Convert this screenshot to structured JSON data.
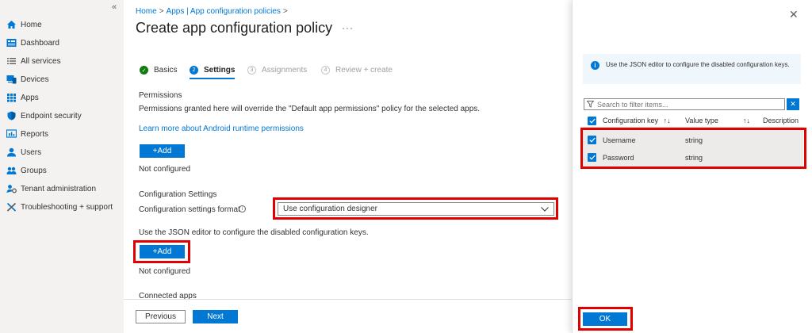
{
  "sidebar": {
    "collapse_label": "«",
    "items": [
      {
        "label": "Home",
        "icon": "home-icon",
        "color": "#0078d4"
      },
      {
        "label": "Dashboard",
        "icon": "dashboard-icon",
        "color": "#0078d4"
      },
      {
        "label": "All services",
        "icon": "list-icon",
        "color": "#605e5c"
      },
      {
        "label": "Devices",
        "icon": "devices-icon",
        "color": "#0078d4"
      },
      {
        "label": "Apps",
        "icon": "apps-icon",
        "color": "#0078d4"
      },
      {
        "label": "Endpoint security",
        "icon": "shield-icon",
        "color": "#0078d4"
      },
      {
        "label": "Reports",
        "icon": "reports-icon",
        "color": "#0078d4"
      },
      {
        "label": "Users",
        "icon": "user-icon",
        "color": "#0078d4"
      },
      {
        "label": "Groups",
        "icon": "groups-icon",
        "color": "#0078d4"
      },
      {
        "label": "Tenant administration",
        "icon": "tenant-gear-icon",
        "color": "#0078d4"
      },
      {
        "label": "Troubleshooting + support",
        "icon": "tools-icon",
        "color": "#0078d4"
      }
    ]
  },
  "breadcrumb": {
    "items": [
      "Home",
      "Apps | App configuration policies"
    ],
    "separator": ">"
  },
  "page": {
    "title": "Create app configuration policy",
    "more_label": "···"
  },
  "steps": [
    {
      "number": "✓",
      "label": "Basics",
      "state": "done"
    },
    {
      "number": "2",
      "label": "Settings",
      "state": "current"
    },
    {
      "number": "3",
      "label": "Assignments",
      "state": "todo"
    },
    {
      "number": "4",
      "label": "Review + create",
      "state": "todo"
    }
  ],
  "permissions": {
    "heading": "Permissions",
    "description": "Permissions granted here will override the \"Default app permissions\" policy for the selected apps.",
    "learn_link": "Learn more about Android runtime permissions",
    "add_label": "+Add",
    "status": "Not configured"
  },
  "config_settings": {
    "heading": "Configuration Settings",
    "format_label": "Configuration settings format",
    "format_value": "Use configuration designer",
    "json_note": "Use the JSON editor to configure the disabled configuration keys.",
    "add_label": "+Add",
    "status": "Not configured"
  },
  "connected_apps": {
    "heading": "Connected apps"
  },
  "footer": {
    "previous_label": "Previous",
    "next_label": "Next"
  },
  "panel": {
    "info_text": "Use the JSON editor to configure the disabled configuration keys.",
    "filter_placeholder": "Search to filter items...",
    "columns": {
      "key": "Configuration key",
      "type": "Value type",
      "description": "Description",
      "sort_glyph": "↑↓"
    },
    "rows": [
      {
        "key": "Username",
        "type": "string",
        "checked": true
      },
      {
        "key": "Password",
        "type": "string",
        "checked": true
      }
    ],
    "ok_label": "OK"
  },
  "colors": {
    "accent": "#0078d4",
    "success": "#107c10",
    "highlight": "#e00000"
  }
}
